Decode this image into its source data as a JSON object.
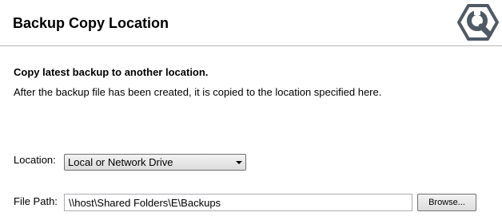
{
  "header": {
    "title": "Backup Copy Location",
    "logo_icon": "wrench-hexagon-logo-icon"
  },
  "section": {
    "heading": "Copy latest backup to another location.",
    "description": "After the backup file has been created, it is copied to the location specified here."
  },
  "location": {
    "label": "Location:",
    "selected": "Local or Network Drive",
    "icon": "chevron-down-icon"
  },
  "file_path": {
    "label": "File Path:",
    "value": "\\\\host\\Shared Folders\\E\\Backups"
  },
  "browse_button": {
    "label": "Browse..."
  },
  "colors": {
    "logo": "#4f5a66",
    "header_border": "#b7b7b7",
    "input_border": "#abadb3"
  }
}
